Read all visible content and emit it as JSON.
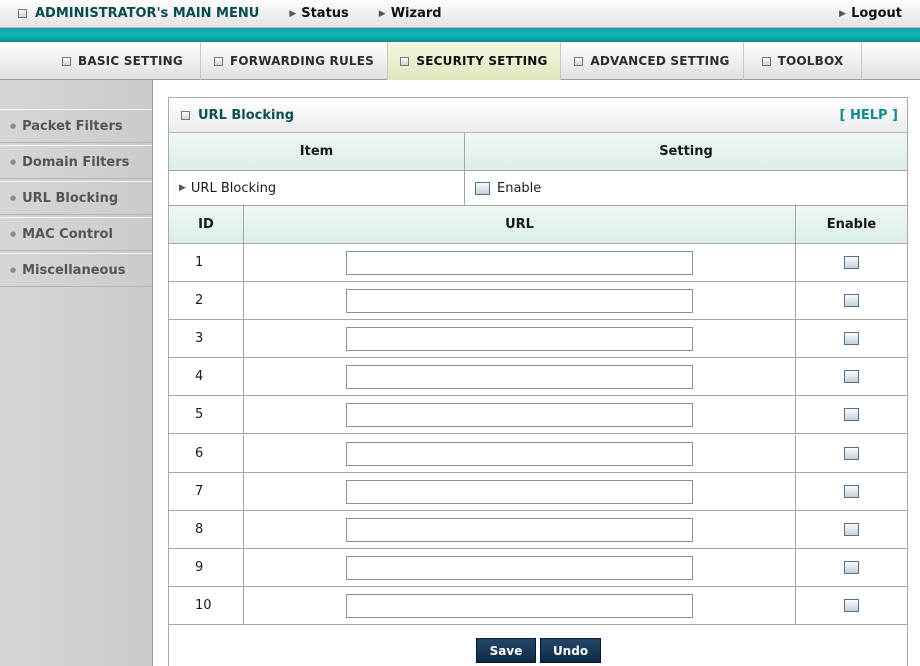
{
  "topbar": {
    "admin_label": "ADMINISTRATOR's MAIN MENU",
    "status_label": "Status",
    "wizard_label": "Wizard",
    "logout_label": "Logout"
  },
  "tabs": [
    {
      "label": "BASIC SETTING",
      "active": false
    },
    {
      "label": "FORWARDING RULES",
      "active": false
    },
    {
      "label": "SECURITY SETTING",
      "active": true
    },
    {
      "label": "ADVANCED SETTING",
      "active": false
    },
    {
      "label": "TOOLBOX",
      "active": false
    }
  ],
  "sidebar": {
    "items": [
      {
        "label": "Packet Filters"
      },
      {
        "label": "Domain Filters"
      },
      {
        "label": "URL Blocking"
      },
      {
        "label": "MAC Control"
      },
      {
        "label": "Miscellaneous"
      }
    ]
  },
  "panel": {
    "title": "URL Blocking",
    "help_label": "[ HELP ]",
    "item_header": "Item",
    "setting_header": "Setting",
    "url_blocking_label": "URL Blocking",
    "enable_label": "Enable",
    "url_blocking_enabled": false,
    "col_id": "ID",
    "col_url": "URL",
    "col_enable": "Enable",
    "rows": [
      {
        "id": "1",
        "url": "",
        "enabled": false
      },
      {
        "id": "2",
        "url": "",
        "enabled": false
      },
      {
        "id": "3",
        "url": "",
        "enabled": false
      },
      {
        "id": "4",
        "url": "",
        "enabled": false
      },
      {
        "id": "5",
        "url": "",
        "enabled": false
      },
      {
        "id": "6",
        "url": "",
        "enabled": false
      },
      {
        "id": "7",
        "url": "",
        "enabled": false
      },
      {
        "id": "8",
        "url": "",
        "enabled": false
      },
      {
        "id": "9",
        "url": "",
        "enabled": false
      },
      {
        "id": "10",
        "url": "",
        "enabled": false
      }
    ]
  },
  "buttons": {
    "save_label": "Save",
    "undo_label": "Undo"
  },
  "colors": {
    "accent_teal": "#13b8b8",
    "button_navy": "#1a3a5c",
    "active_tab": "#dde8bd"
  }
}
